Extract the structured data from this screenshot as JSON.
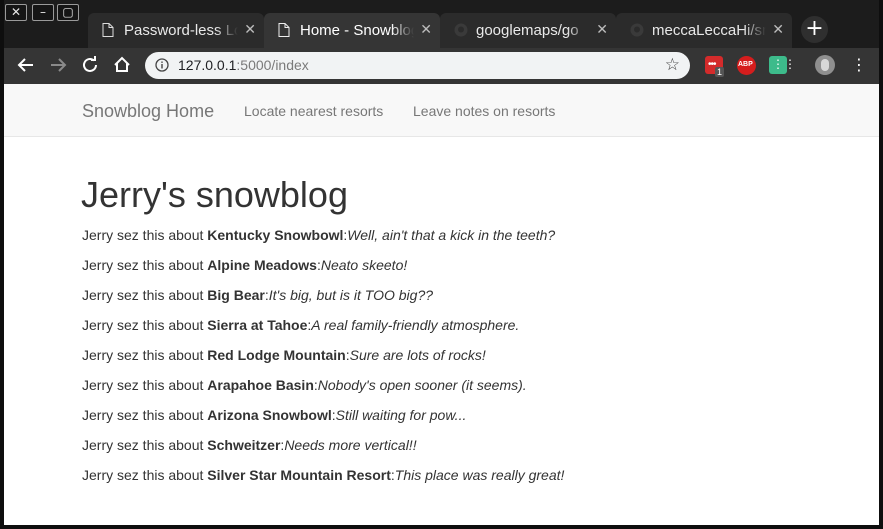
{
  "browser": {
    "tabs": [
      {
        "title": "Password-less Lo",
        "active": false
      },
      {
        "title": "Home - Snowblog",
        "active": true
      },
      {
        "title": "googlemaps/go",
        "active": false
      },
      {
        "title": "meccaLeccaHi/sn",
        "active": false
      }
    ],
    "close_glyph": "✕",
    "new_tab_glyph": "+",
    "url_host": "127.0.0.1",
    "url_path": ":5000/index",
    "star_glyph": "☆",
    "ext_badge": "1",
    "ext_abp": "ABP"
  },
  "navbar": {
    "brand": "Snowblog Home",
    "links": [
      "Locate nearest resorts",
      "Leave notes on resorts"
    ]
  },
  "main": {
    "heading": "Jerry's snowblog",
    "prefix": "Jerry sez this about ",
    "entries": [
      {
        "resort": "Kentucky Snowbowl",
        "note": "Well, ain't that a kick in the teeth?"
      },
      {
        "resort": "Alpine Meadows",
        "note": "Neato skeeto!"
      },
      {
        "resort": "Big Bear",
        "note": "It's big, but is it TOO big??"
      },
      {
        "resort": "Sierra at Tahoe",
        "note": "A real family-friendly atmosphere."
      },
      {
        "resort": "Red Lodge Mountain",
        "note": "Sure are lots of rocks!"
      },
      {
        "resort": "Arapahoe Basin",
        "note": "Nobody's open sooner (it seems)."
      },
      {
        "resort": "Arizona Snowbowl",
        "note": "Still waiting for pow..."
      },
      {
        "resort": "Schweitzer",
        "note": "Needs more vertical!!"
      },
      {
        "resort": "Silver Star Mountain Resort",
        "note": "This place was really great!"
      }
    ]
  }
}
